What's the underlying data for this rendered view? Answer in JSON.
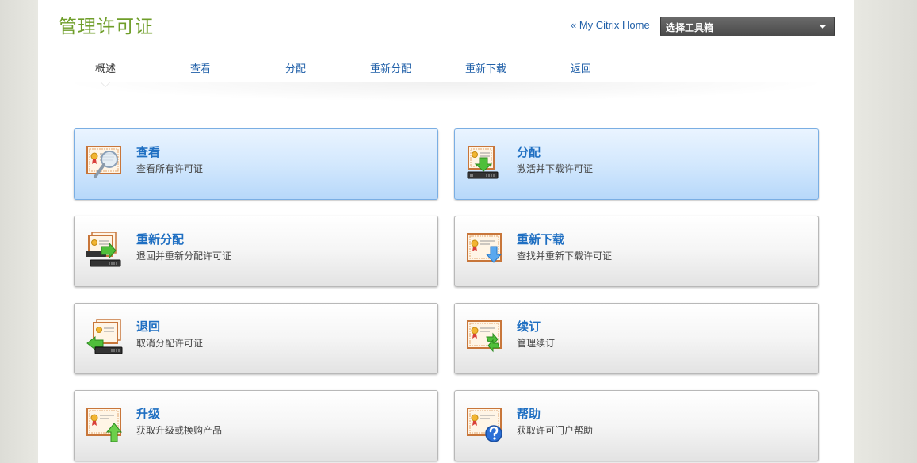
{
  "header": {
    "title": "管理许可证",
    "home_link": "« My Citrix Home",
    "toolbox_label": "选择工具箱"
  },
  "tabs": [
    {
      "label": "概述",
      "active": true
    },
    {
      "label": "查看"
    },
    {
      "label": "分配"
    },
    {
      "label": "重新分配"
    },
    {
      "label": "重新下载"
    },
    {
      "label": "返回"
    }
  ],
  "cards": [
    {
      "title": "查看",
      "subtitle": "查看所有许可证",
      "icon": "certificate-magnifier-icon",
      "highlighted": true
    },
    {
      "title": "分配",
      "subtitle": "激活并下载许可证",
      "icon": "certificate-download-server-icon",
      "highlighted": true
    },
    {
      "title": "重新分配",
      "subtitle": "退回并重新分配许可证",
      "icon": "certificate-reallocate-icon"
    },
    {
      "title": "重新下载",
      "subtitle": "查找并重新下载许可证",
      "icon": "certificate-redownload-icon"
    },
    {
      "title": "退回",
      "subtitle": "取消分配许可证",
      "icon": "certificate-return-icon"
    },
    {
      "title": "续订",
      "subtitle": "管理续订",
      "icon": "certificate-renew-icon"
    },
    {
      "title": "升级",
      "subtitle": "获取升级或换购产品",
      "icon": "certificate-upgrade-icon"
    },
    {
      "title": "帮助",
      "subtitle": "获取许可门户帮助",
      "icon": "certificate-help-icon"
    }
  ],
  "colors": {
    "title_green": "#6f9e2a",
    "link_blue": "#1f5fa8",
    "card_title_blue": "#1f6fc2",
    "highlight_blue": "#b7d8fa"
  }
}
